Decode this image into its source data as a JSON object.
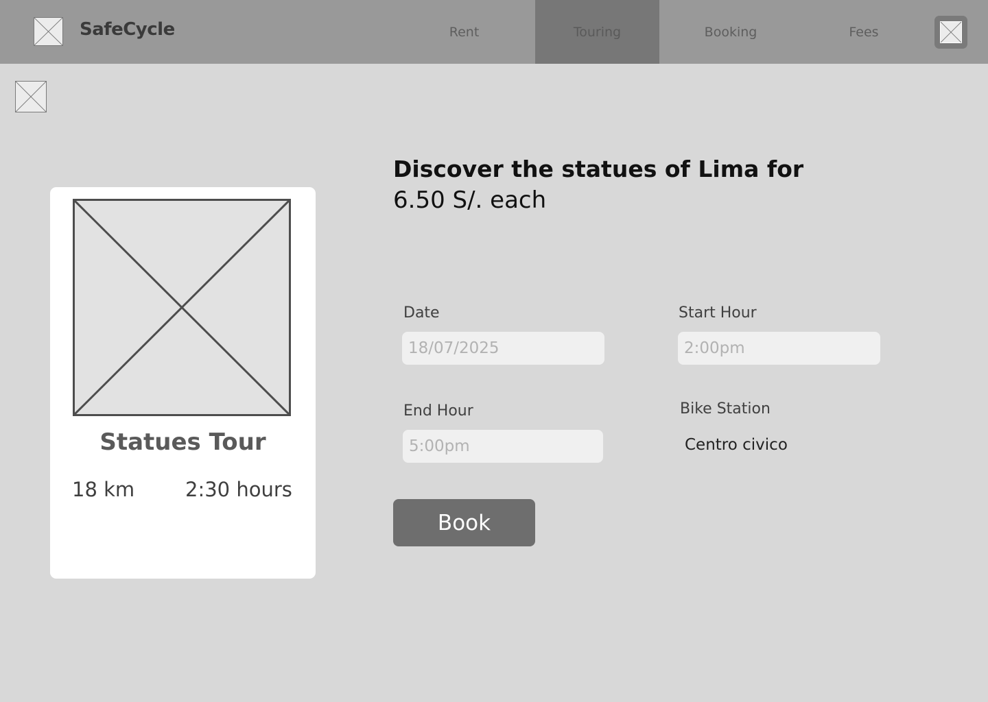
{
  "header": {
    "logo_icon": "image-placeholder-icon",
    "brand": "SafeCycle",
    "nav": [
      {
        "label": "Rent",
        "active": false
      },
      {
        "label": "Touring",
        "active": true
      },
      {
        "label": "Booking",
        "active": false
      },
      {
        "label": "Fees",
        "active": false
      }
    ],
    "profile_icon": "image-placeholder-icon"
  },
  "back_icon": "image-placeholder-icon",
  "tour_card": {
    "image_icon": "image-placeholder-icon",
    "title": "Statues Tour",
    "distance": "18 km",
    "duration": "2:30 hours"
  },
  "offer": {
    "heading": "Discover the statues of Lima for",
    "price": "6.50 S/. each"
  },
  "form": {
    "date": {
      "label": "Date",
      "placeholder": "18/07/2025"
    },
    "start_hour": {
      "label": "Start Hour",
      "placeholder": "2:00pm"
    },
    "end_hour": {
      "label": "End Hour",
      "placeholder": "5:00pm"
    },
    "bike_station": {
      "label": "Bike Station",
      "value": "Centro civico"
    },
    "book_label": "Book"
  },
  "colors": {
    "header_bg": "#999999",
    "nav_active_bg": "#777777",
    "page_bg": "#d8d8d8",
    "button_bg": "#6e6e6e"
  }
}
